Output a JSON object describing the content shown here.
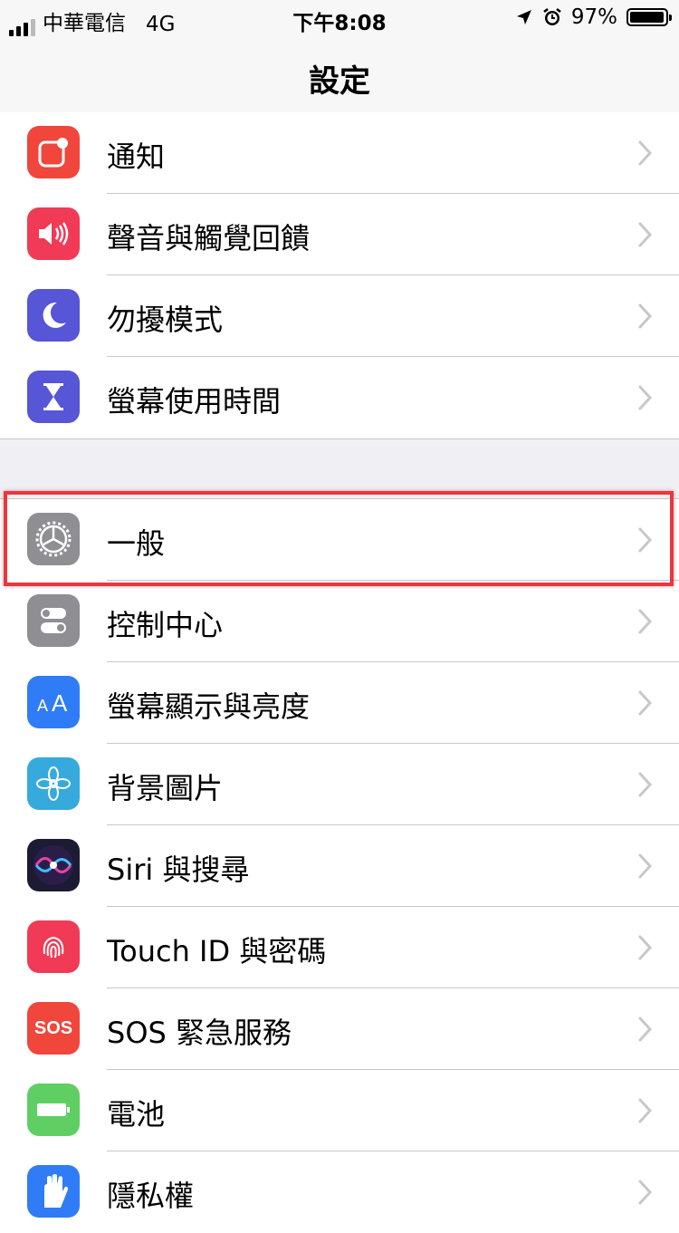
{
  "status_bar": {
    "carrier": "中華電信",
    "network": "4G",
    "time": "下午8:08",
    "battery": "97%",
    "battery_level": 0.97
  },
  "nav": {
    "title": "設定"
  },
  "group1": [
    {
      "label": "通知",
      "icon": "notifications-icon",
      "color": "#f0463b"
    },
    {
      "label": "聲音與觸覺回饋",
      "icon": "sounds-icon",
      "color": "#f13a56"
    },
    {
      "label": "勿擾模式",
      "icon": "moon-icon",
      "color": "#5756d6"
    },
    {
      "label": "螢幕使用時間",
      "icon": "hourglass-icon",
      "color": "#5756d6"
    }
  ],
  "group2": [
    {
      "label": "一般",
      "icon": "gear-icon",
      "color": "#8e8e93"
    },
    {
      "label": "控制中心",
      "icon": "switches-icon",
      "color": "#8e8e93"
    },
    {
      "label": "螢幕顯示與亮度",
      "icon": "text-size-icon",
      "color": "#2f7cf6",
      "glyph": "AA"
    },
    {
      "label": "背景圖片",
      "icon": "flower-icon",
      "color": "#36aadc"
    },
    {
      "label": "Siri 與搜尋",
      "icon": "siri-icon",
      "color": "#1b1b33"
    },
    {
      "label": "Touch ID 與密碼",
      "icon": "fingerprint-icon",
      "color": "#f13a56"
    },
    {
      "label": "SOS 緊急服務",
      "icon": "sos-icon",
      "color": "#f0463b",
      "glyph": "SOS"
    },
    {
      "label": "電池",
      "icon": "battery-icon",
      "color": "#5fcf63"
    },
    {
      "label": "隱私權",
      "icon": "hand-icon",
      "color": "#2f7cf6"
    }
  ],
  "highlight": {
    "color": "#e8373f"
  }
}
